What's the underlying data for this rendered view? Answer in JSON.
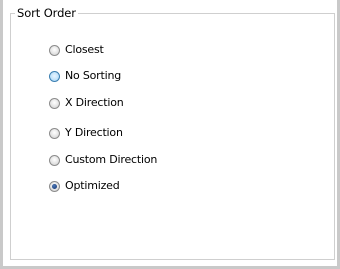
{
  "group": {
    "title": "Sort Order"
  },
  "options": [
    {
      "label": "Closest",
      "checked": false,
      "hover": false
    },
    {
      "label": "No Sorting",
      "checked": false,
      "hover": true
    },
    {
      "label": "X Direction",
      "checked": false,
      "hover": false
    },
    {
      "label": "Y Direction",
      "checked": false,
      "hover": false
    },
    {
      "label": "Custom Direction",
      "checked": false,
      "hover": false
    },
    {
      "label": "Optimized",
      "checked": true,
      "hover": false
    }
  ],
  "colors": {
    "frame": "#c9c9c9",
    "group_border": "#cfcfcf",
    "hover_radio": "#8fc8ee",
    "checked_dot": "#1c3f7a"
  }
}
